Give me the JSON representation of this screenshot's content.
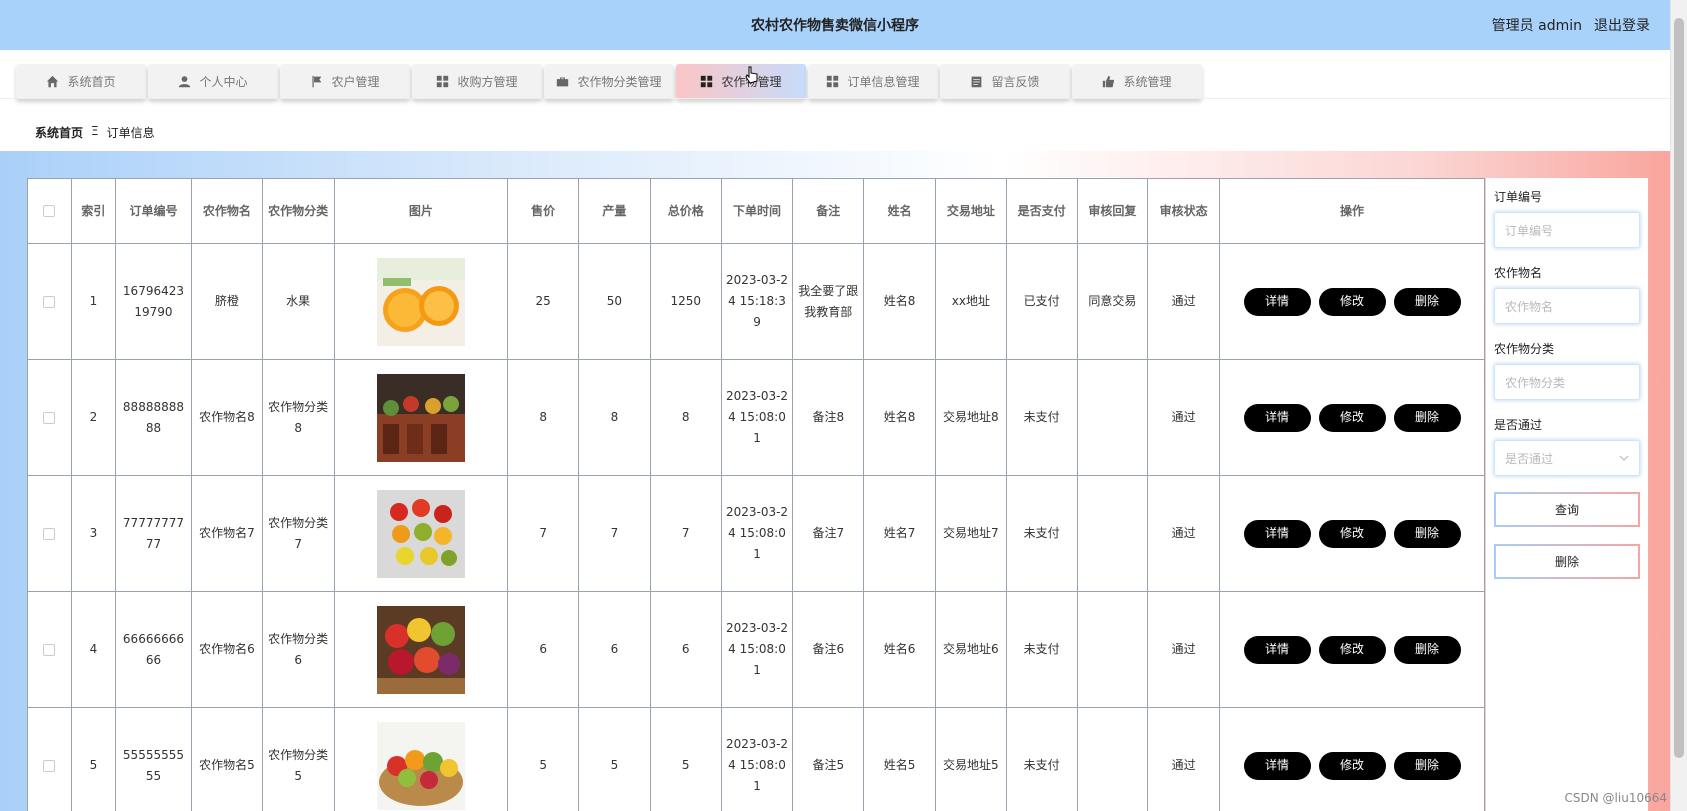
{
  "header": {
    "title": "农村农作物售卖微信小程序",
    "user": "管理员 admin",
    "logout": "退出登录"
  },
  "nav": [
    {
      "label": "系统首页",
      "icon": "home-icon"
    },
    {
      "label": "个人中心",
      "icon": "user-icon"
    },
    {
      "label": "农户管理",
      "icon": "flag-icon"
    },
    {
      "label": "收购方管理",
      "icon": "grid-icon"
    },
    {
      "label": "农作物分类管理",
      "icon": "briefcase-icon"
    },
    {
      "label": "农作物管理",
      "icon": "grid-icon"
    },
    {
      "label": "订单信息管理",
      "icon": "grid-icon"
    },
    {
      "label": "留言反馈",
      "icon": "clipboard-icon"
    },
    {
      "label": "系统管理",
      "icon": "thumbs-up-icon"
    }
  ],
  "breadcrumb": {
    "home": "系统首页",
    "sep": "Ξ",
    "current": "订单信息"
  },
  "table": {
    "headers": [
      "索引",
      "订单编号",
      "农作物名",
      "农作物分类",
      "图片",
      "售价",
      "产量",
      "总价格",
      "下单时间",
      "备注",
      "姓名",
      "交易地址",
      "是否支付",
      "审核回复",
      "审核状态",
      "操作"
    ],
    "rows": [
      {
        "idx": "1",
        "order_no": "1679642319790",
        "name": "脐橙",
        "category": "水果",
        "image": "orange-photo",
        "price": "25",
        "yield": "50",
        "total": "1250",
        "time": "2023-03-24 15:18:39",
        "note": "我全要了跟我教育部",
        "person": "姓名8",
        "address": "xx地址",
        "paid": "已支付",
        "reply": "同意交易",
        "status": "通过"
      },
      {
        "idx": "2",
        "order_no": "8888888888",
        "name": "农作物名8",
        "category": "农作物分类8",
        "image": "market-stall-photo",
        "price": "8",
        "yield": "8",
        "total": "8",
        "time": "2023-03-24 15:08:01",
        "note": "备注8",
        "person": "姓名8",
        "address": "交易地址8",
        "paid": "未支付",
        "reply": "",
        "status": "通过"
      },
      {
        "idx": "3",
        "order_no": "7777777777",
        "name": "农作物名7",
        "category": "农作物分类7",
        "image": "peppers-photo",
        "price": "7",
        "yield": "7",
        "total": "7",
        "time": "2023-03-24 15:08:01",
        "note": "备注7",
        "person": "姓名7",
        "address": "交易地址7",
        "paid": "未支付",
        "reply": "",
        "status": "通过"
      },
      {
        "idx": "4",
        "order_no": "6666666666",
        "name": "农作物名6",
        "category": "农作物分类6",
        "image": "fruit-basket-photo",
        "price": "6",
        "yield": "6",
        "total": "6",
        "time": "2023-03-24 15:08:01",
        "note": "备注6",
        "person": "姓名6",
        "address": "交易地址6",
        "paid": "未支付",
        "reply": "",
        "status": "通过"
      },
      {
        "idx": "5",
        "order_no": "5555555555",
        "name": "农作物名5",
        "category": "农作物分类5",
        "image": "veggie-basket-photo",
        "price": "5",
        "yield": "5",
        "total": "5",
        "time": "2023-03-24 15:08:01",
        "note": "备注5",
        "person": "姓名5",
        "address": "交易地址5",
        "paid": "未支付",
        "reply": "",
        "status": "通过"
      }
    ],
    "actions": {
      "detail": "详情",
      "edit": "修改",
      "delete": "删除"
    }
  },
  "filter": {
    "order_no": {
      "label": "订单编号",
      "placeholder": "订单编号"
    },
    "crop_name": {
      "label": "农作物名",
      "placeholder": "农作物名"
    },
    "crop_category": {
      "label": "农作物分类",
      "placeholder": "农作物分类"
    },
    "approved": {
      "label": "是否通过",
      "placeholder": "是否通过"
    },
    "search_btn": "查询",
    "delete_btn": "删除"
  },
  "watermark": "CSDN @liu10664"
}
